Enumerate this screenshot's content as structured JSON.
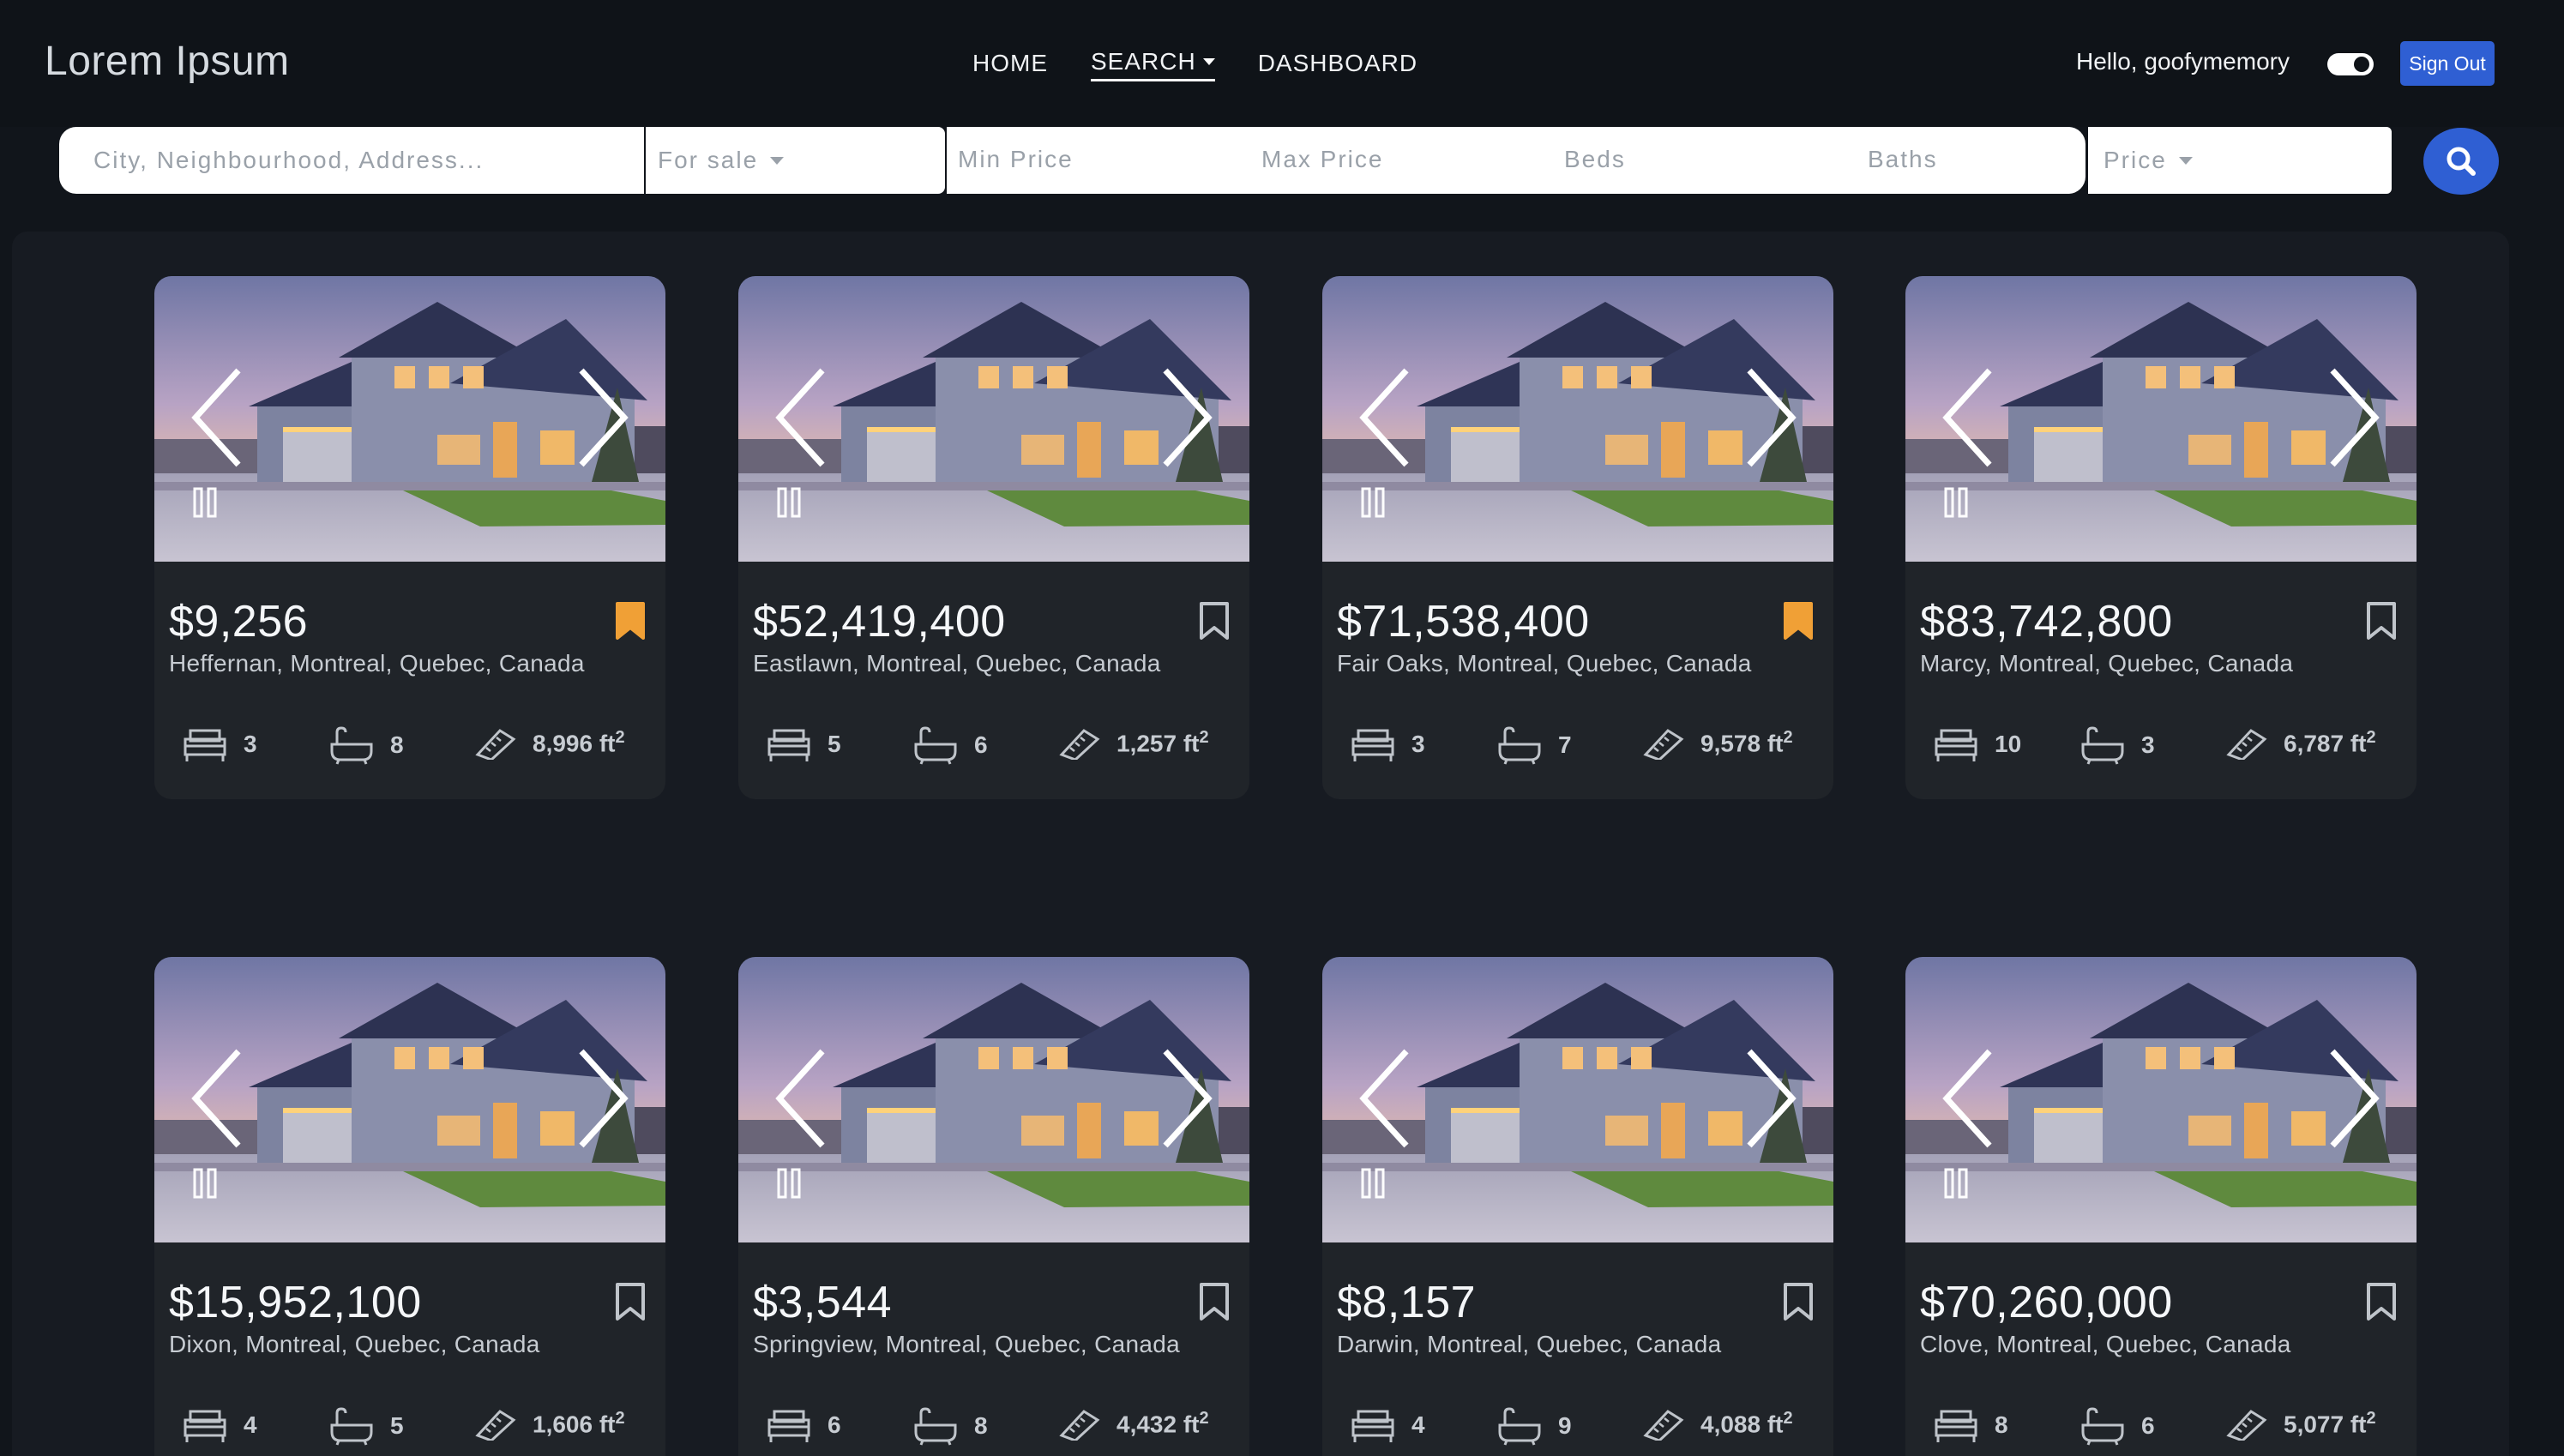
{
  "brand": "Lorem Ipsum",
  "nav": {
    "home": "HOME",
    "search": "SEARCH",
    "dashboard": "DASHBOARD"
  },
  "user": {
    "greeting": "Hello, goofymemory",
    "sign_out": "Sign Out",
    "theme_toggle_on": true
  },
  "search": {
    "location_placeholder": "City, Neighbourhood, Address...",
    "listing_type": "For sale",
    "min_price": "Min Price",
    "max_price": "Max Price",
    "beds": "Beds",
    "baths": "Baths",
    "sort": "Price"
  },
  "colors": {
    "accent": "#2f5fd3",
    "bookmark_saved": "#f0a036",
    "card_bg": "#202429"
  },
  "area_unit": "ft",
  "listings": [
    {
      "price": "$9,256",
      "address": "Heffernan, Montreal, Quebec, Canada",
      "beds": "3",
      "baths": "8",
      "area": "8,996",
      "saved": true
    },
    {
      "price": "$52,419,400",
      "address": "Eastlawn, Montreal, Quebec, Canada",
      "beds": "5",
      "baths": "6",
      "area": "1,257",
      "saved": false
    },
    {
      "price": "$71,538,400",
      "address": "Fair Oaks, Montreal, Quebec, Canada",
      "beds": "3",
      "baths": "7",
      "area": "9,578",
      "saved": true
    },
    {
      "price": "$83,742,800",
      "address": "Marcy, Montreal, Quebec, Canada",
      "beds": "10",
      "baths": "3",
      "area": "6,787",
      "saved": false
    },
    {
      "price": "$15,952,100",
      "address": "Dixon, Montreal, Quebec, Canada",
      "beds": "4",
      "baths": "5",
      "area": "1,606",
      "saved": false
    },
    {
      "price": "$3,544",
      "address": "Springview, Montreal, Quebec, Canada",
      "beds": "6",
      "baths": "8",
      "area": "4,432",
      "saved": false
    },
    {
      "price": "$8,157",
      "address": "Darwin, Montreal, Quebec, Canada",
      "beds": "4",
      "baths": "9",
      "area": "4,088",
      "saved": false
    },
    {
      "price": "$70,260,000",
      "address": "Clove, Montreal, Quebec, Canada",
      "beds": "8",
      "baths": "6",
      "area": "5,077",
      "saved": false
    }
  ]
}
